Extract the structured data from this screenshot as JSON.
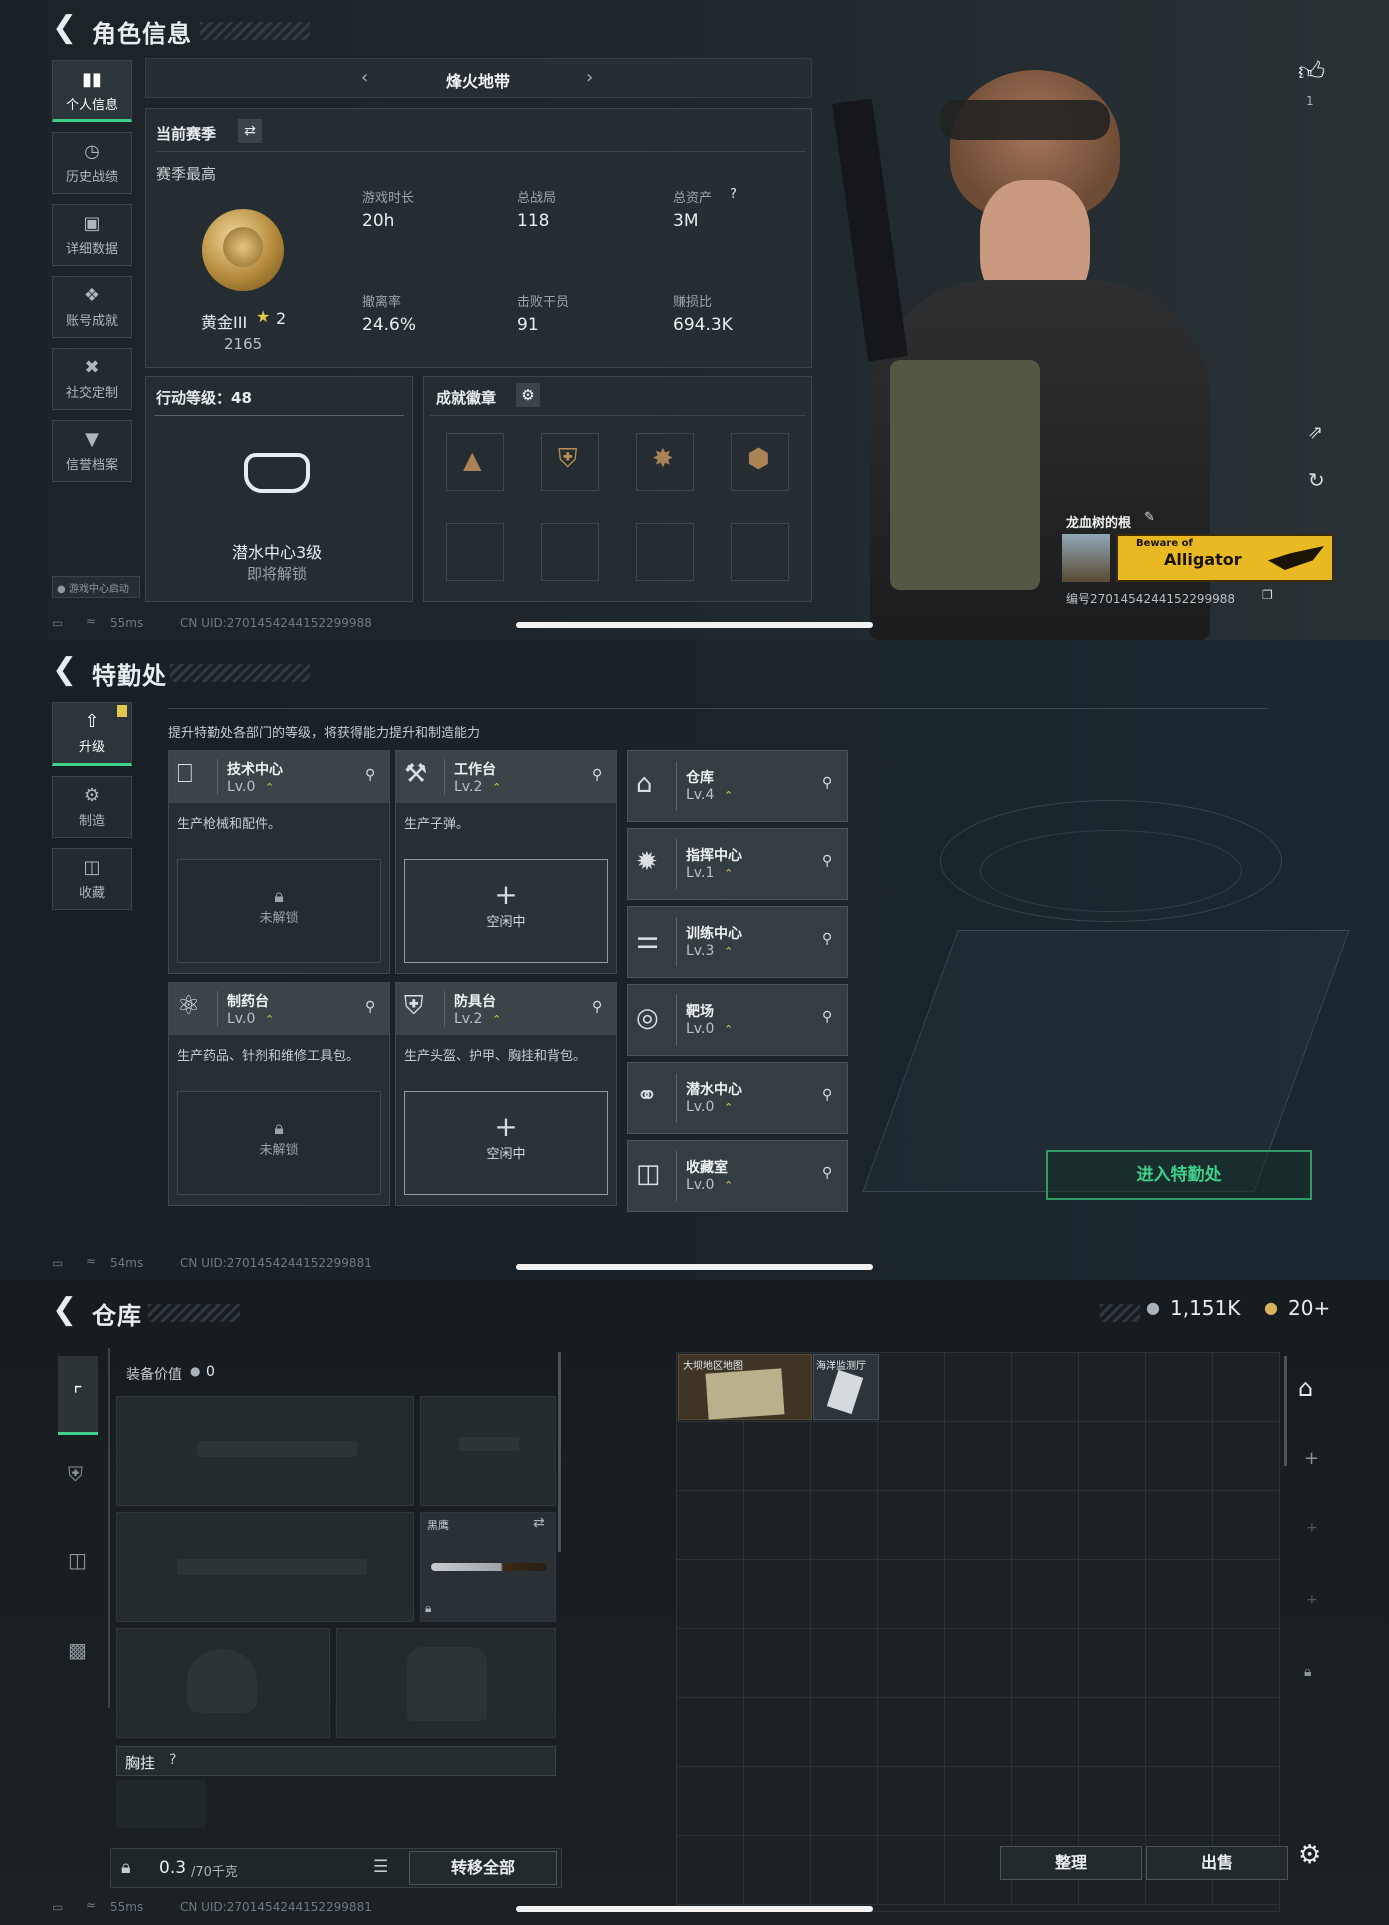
{
  "profile": {
    "title": "角色信息",
    "nav": [
      "个人信息",
      "历史战绩",
      "详细数据",
      "账号成就",
      "社交定制",
      "信誉档案"
    ],
    "mode_selector": "烽火地带",
    "season_label": "当前赛季",
    "season_best_label": "赛季最高",
    "rank_name": "黄金III",
    "rank_stars": "2",
    "rank_points": "2165",
    "stats": [
      {
        "label": "游戏时长",
        "value": "20h"
      },
      {
        "label": "总战局",
        "value": "118"
      },
      {
        "label": "总资产",
        "value": "3M"
      },
      {
        "label": "撤离率",
        "value": "24.6%"
      },
      {
        "label": "击败干员",
        "value": "91"
      },
      {
        "label": "赚损比",
        "value": "694.3K"
      }
    ],
    "help_mark": "?",
    "action_level_label": "行动等级：48",
    "unlock_name": "潜水中心3级",
    "unlock_status": "即将解锁",
    "achievements_label": "成就徽章",
    "likes_count": "1",
    "player_name": "龙血树的根",
    "banner_line1": "Beware of",
    "banner_line2": "Alligator",
    "player_id": "编号2701454244152299988",
    "game_center": "游戏中心启动",
    "status_ping": "55ms",
    "status_uid": "CN UID:2701454244152299988"
  },
  "special_ops": {
    "title": "特勤处",
    "nav": [
      "升级",
      "制造",
      "收藏"
    ],
    "hint": "提升特勤处各部门的等级，将获得能力提升和制造能力",
    "left_depts": [
      {
        "name": "技术中心",
        "level": "Lv.0",
        "desc": "生产枪械和配件。",
        "slot": "未解锁"
      },
      {
        "name": "工作台",
        "level": "Lv.2",
        "desc": "生产子弹。",
        "slot": "空闲中"
      },
      {
        "name": "制药台",
        "level": "Lv.0",
        "desc": "生产药品、针剂和维修工具包。",
        "slot": "未解锁"
      },
      {
        "name": "防具台",
        "level": "Lv.2",
        "desc": "生产头盔、护甲、胸挂和背包。",
        "slot": "空闲中"
      }
    ],
    "right_depts": [
      {
        "name": "仓库",
        "level": "Lv.4"
      },
      {
        "name": "指挥中心",
        "level": "Lv.1"
      },
      {
        "name": "训练中心",
        "level": "Lv.3"
      },
      {
        "name": "靶场",
        "level": "Lv.0"
      },
      {
        "name": "潜水中心",
        "level": "Lv.0"
      },
      {
        "name": "收藏室",
        "level": "Lv.0"
      }
    ],
    "enter_button": "进入特勤处",
    "status_ping": "54ms",
    "status_uid": "CN UID:2701454244152299881"
  },
  "warehouse": {
    "title": "仓库",
    "currency1": "1,151K",
    "currency2": "20+",
    "equip_value_label": "装备价值",
    "equip_value": "0",
    "knife_name": "黑鹰",
    "chest_rig_label": "胸挂",
    "help_mark": "?",
    "weight_current": "0.3",
    "weight_max": "/70千克",
    "transfer_all": "转移全部",
    "item1": "大坝地区地图",
    "item2": "海洋监测厅",
    "sort_button": "整理",
    "sell_button": "出售",
    "status_ping": "55ms",
    "status_uid": "CN UID:2701454244152299881"
  },
  "colors": {
    "accent_green": "#3fd08a",
    "gold": "#e0c94a",
    "banner_yellow": "#e8b923"
  }
}
